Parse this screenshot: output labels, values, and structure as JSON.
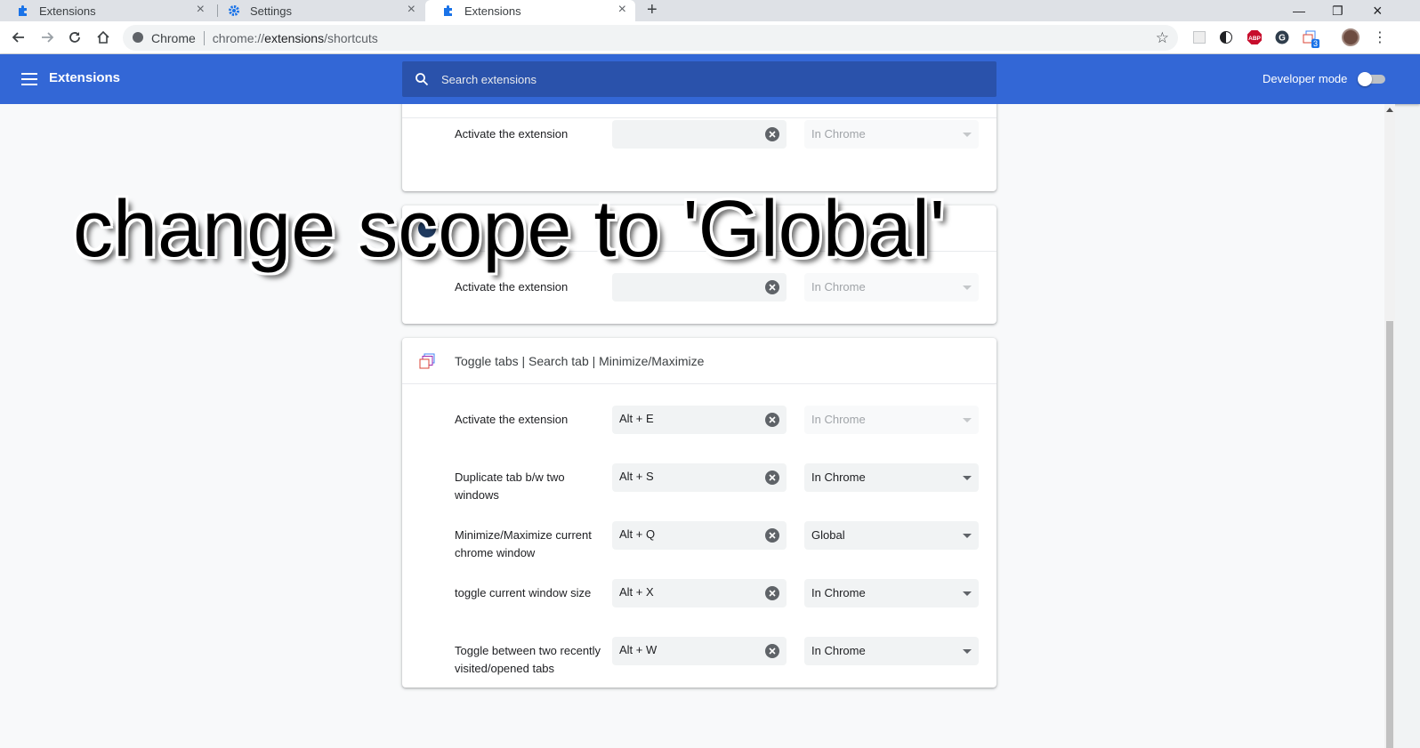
{
  "browser": {
    "tabs": [
      {
        "label": "Extensions",
        "icon": "puzzle-icon"
      },
      {
        "label": "Settings",
        "icon": "gear-icon"
      },
      {
        "label": "Extensions",
        "icon": "puzzle-icon",
        "active": true
      }
    ],
    "new_tab": "+",
    "omnibox": {
      "site_label": "Chrome",
      "url_prefix": "chrome://",
      "url_host": "extensions",
      "url_path": "/shortcuts"
    },
    "extensions_badge": "3"
  },
  "appbar": {
    "title": "Extensions",
    "search_placeholder": "Search extensions",
    "developer_mode_label": "Developer mode",
    "developer_mode_on": false
  },
  "cards": [
    {
      "name": "",
      "rows": [
        {
          "command": "Activate the extension",
          "shortcut": "",
          "scope": "In Chrome",
          "scope_enabled": false
        }
      ]
    },
    {
      "name": "",
      "rows": [
        {
          "command": "Activate the extension",
          "shortcut": "",
          "scope": "In Chrome",
          "scope_enabled": false
        }
      ]
    },
    {
      "name": "Toggle tabs | Search tab | Minimize/Maximize",
      "rows": [
        {
          "command": "Activate the extension",
          "shortcut": "Alt + E",
          "scope": "In Chrome",
          "scope_enabled": false
        },
        {
          "command": "Duplicate tab b/w two windows",
          "shortcut": "Alt + S",
          "scope": "In Chrome",
          "scope_enabled": true
        },
        {
          "command": "Minimize/Maximize current chrome window",
          "shortcut": "Alt + Q",
          "scope": "Global",
          "scope_enabled": true
        },
        {
          "command": "toggle current window size",
          "shortcut": "Alt + X",
          "scope": "In Chrome",
          "scope_enabled": true
        },
        {
          "command": "Toggle between two recently visited/opened tabs",
          "shortcut": "Alt + W",
          "scope": "In Chrome",
          "scope_enabled": true
        }
      ]
    }
  ],
  "overlay_caption": "change scope to 'Global'",
  "colors": {
    "appbar": "#3367d6",
    "search_bg": "#2a52ab",
    "abp_red": "#c70d2c"
  }
}
